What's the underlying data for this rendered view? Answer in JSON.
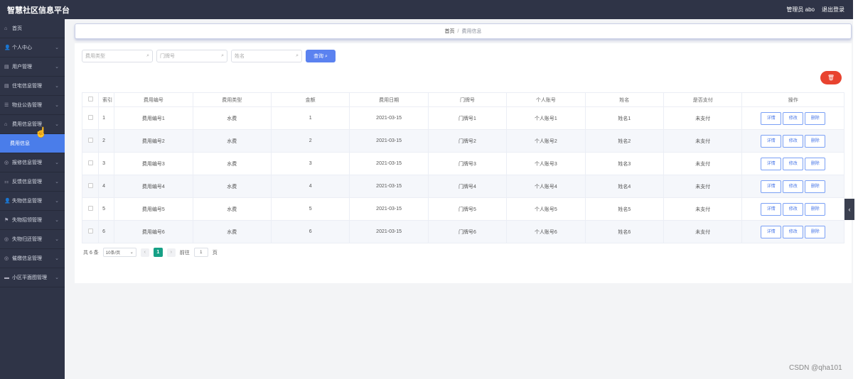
{
  "app": {
    "title": "智慧社区信息平台",
    "admin_label": "管理员 abo",
    "logout_label": "退出登录"
  },
  "sidebar": {
    "items": [
      {
        "icon": "home-icon",
        "glyph": "⌂",
        "label": "首页",
        "chevron": false
      },
      {
        "icon": "user-icon",
        "glyph": "👤",
        "label": "个人中心",
        "chevron": true
      },
      {
        "icon": "users-icon",
        "glyph": "▤",
        "label": "用户管理",
        "chevron": true
      },
      {
        "icon": "house-icon",
        "glyph": "▤",
        "label": "住宅信息管理",
        "chevron": true
      },
      {
        "icon": "notice-icon",
        "glyph": "☰",
        "label": "物业公告管理",
        "chevron": true
      },
      {
        "icon": "fee-icon",
        "glyph": "⌂",
        "label": "费用信息管理",
        "chevron": true
      },
      {
        "icon": "",
        "glyph": "",
        "label": "费用信息",
        "chevron": false,
        "sub": true,
        "active": true
      },
      {
        "icon": "repair-icon",
        "glyph": "◎",
        "label": "报修信息管理",
        "chevron": true
      },
      {
        "icon": "feedback-icon",
        "glyph": "⚏",
        "label": "反馈信息管理",
        "chevron": true
      },
      {
        "icon": "lost-icon",
        "glyph": "👤",
        "label": "失物信息管理",
        "chevron": true
      },
      {
        "icon": "flag-icon",
        "glyph": "⚑",
        "label": "失物招领管理",
        "chevron": true
      },
      {
        "icon": "return-icon",
        "glyph": "◎",
        "label": "失物归还管理",
        "chevron": true
      },
      {
        "icon": "bell-icon",
        "glyph": "◎",
        "label": "催缴信息管理",
        "chevron": true
      },
      {
        "icon": "settings-icon",
        "glyph": "▬",
        "label": "小区平面图管理",
        "chevron": true
      }
    ]
  },
  "breadcrumb": {
    "home": "首页",
    "separator": "/",
    "current": "费用信息"
  },
  "search": {
    "fee_type_placeholder": "费用类型",
    "door_placeholder": "门牌号",
    "name_placeholder": "姓名",
    "button_label": "查询 ⌕"
  },
  "table": {
    "headers": [
      "索引",
      "费用编号",
      "费用类型",
      "金额",
      "费用日期",
      "门牌号",
      "个人账号",
      "姓名",
      "是否支付",
      "操作"
    ],
    "action_labels": {
      "detail": "详情",
      "edit": "修改",
      "delete": "删除"
    },
    "rows": [
      {
        "index": "1",
        "fee_no": "费用编号1",
        "fee_type": "水费",
        "amount": "1",
        "date": "2021-03-15",
        "door": "门牌号1",
        "account": "个人账号1",
        "name": "姓名1",
        "paid": "未支付"
      },
      {
        "index": "2",
        "fee_no": "费用编号2",
        "fee_type": "水费",
        "amount": "2",
        "date": "2021-03-15",
        "door": "门牌号2",
        "account": "个人账号2",
        "name": "姓名2",
        "paid": "未支付"
      },
      {
        "index": "3",
        "fee_no": "费用编号3",
        "fee_type": "水费",
        "amount": "3",
        "date": "2021-03-15",
        "door": "门牌号3",
        "account": "个人账号3",
        "name": "姓名3",
        "paid": "未支付"
      },
      {
        "index": "4",
        "fee_no": "费用编号4",
        "fee_type": "水费",
        "amount": "4",
        "date": "2021-03-15",
        "door": "门牌号4",
        "account": "个人账号4",
        "name": "姓名4",
        "paid": "未支付"
      },
      {
        "index": "5",
        "fee_no": "费用编号5",
        "fee_type": "水费",
        "amount": "5",
        "date": "2021-03-15",
        "door": "门牌号5",
        "account": "个人账号5",
        "name": "姓名5",
        "paid": "未支付"
      },
      {
        "index": "6",
        "fee_no": "费用编号6",
        "fee_type": "水费",
        "amount": "6",
        "date": "2021-03-15",
        "door": "门牌号6",
        "account": "个人账号6",
        "name": "姓名6",
        "paid": "未支付"
      }
    ]
  },
  "pagination": {
    "total": "共 6 条",
    "page_size": "10条/页",
    "current_page": "1",
    "goto_label": "前往",
    "goto_value": "1",
    "page_suffix": "页"
  },
  "watermark": "CSDN @qha101"
}
